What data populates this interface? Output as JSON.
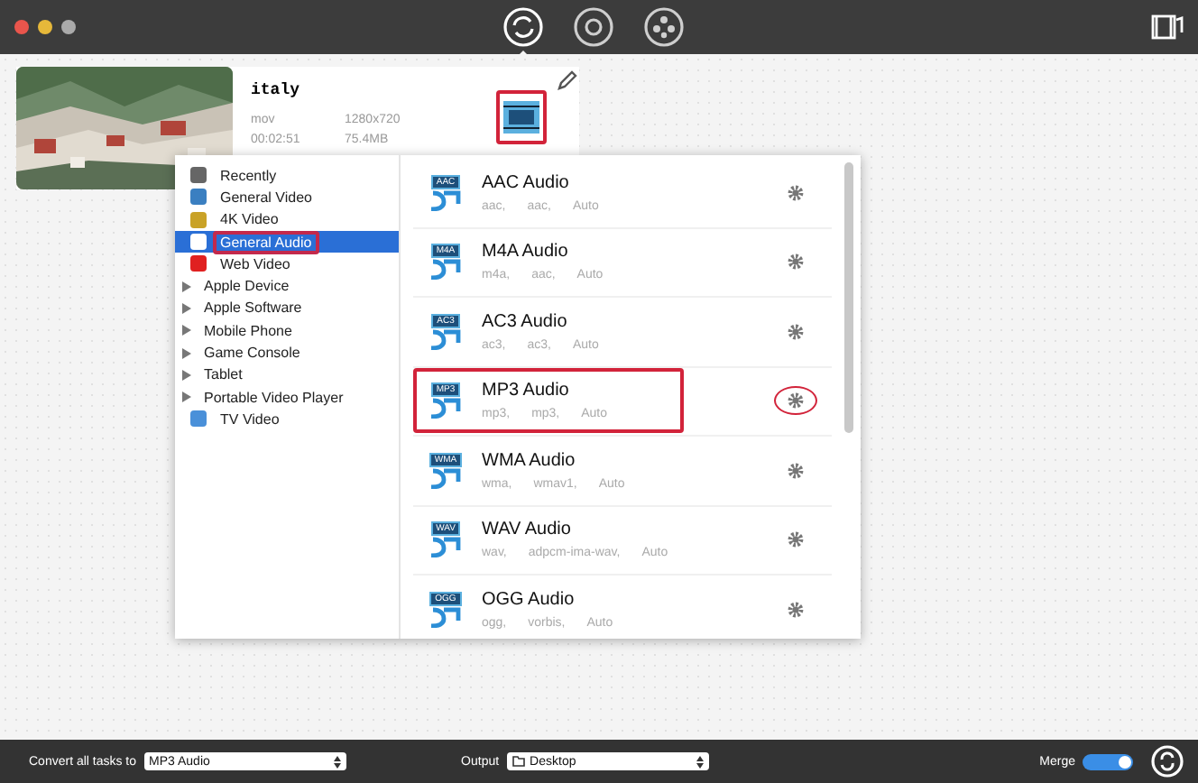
{
  "toolbar": {
    "tabs": [
      {
        "selected": true
      },
      {
        "selected": false
      },
      {
        "selected": false
      }
    ]
  },
  "video": {
    "title": "italy",
    "format": "mov",
    "resolution": "1280x720",
    "duration": "00:02:51",
    "size": "75.4MB",
    "target_marked": true
  },
  "categories": [
    {
      "label": "Recently",
      "kind": "leaf",
      "selected": false,
      "marked": false
    },
    {
      "label": "General Video",
      "kind": "leaf",
      "selected": false,
      "marked": false
    },
    {
      "label": "4K Video",
      "kind": "leaf",
      "selected": false,
      "marked": false
    },
    {
      "label": "General Audio",
      "kind": "leaf",
      "selected": true,
      "marked": true
    },
    {
      "label": "Web Video",
      "kind": "leaf",
      "selected": false,
      "marked": false
    },
    {
      "label": "Apple Device",
      "kind": "group",
      "selected": false,
      "marked": false
    },
    {
      "label": "Apple Software",
      "kind": "group",
      "selected": false,
      "marked": false
    },
    {
      "label": "Mobile Phone",
      "kind": "group",
      "selected": false,
      "marked": false
    },
    {
      "label": "Game Console",
      "kind": "group",
      "selected": false,
      "marked": false
    },
    {
      "label": "Tablet",
      "kind": "group",
      "selected": false,
      "marked": false
    },
    {
      "label": "Portable Video Player",
      "kind": "group",
      "selected": false,
      "marked": false
    },
    {
      "label": "TV Video",
      "kind": "leaf",
      "selected": false,
      "marked": false
    }
  ],
  "formats": [
    {
      "name": "AAC Audio",
      "details": [
        "aac,",
        "aac,",
        "Auto"
      ],
      "marked": false,
      "badge": "AAC"
    },
    {
      "name": "M4A Audio",
      "details": [
        "m4a,",
        "aac,",
        "Auto"
      ],
      "marked": false,
      "badge": "M4A"
    },
    {
      "name": "AC3 Audio",
      "details": [
        "ac3,",
        "ac3,",
        "Auto"
      ],
      "marked": false,
      "badge": "AC3"
    },
    {
      "name": "MP3 Audio",
      "details": [
        "mp3,",
        "mp3,",
        "Auto"
      ],
      "marked": true,
      "badge": "MP3"
    },
    {
      "name": "WMA Audio",
      "details": [
        "wma,",
        "wmav1,",
        "Auto"
      ],
      "marked": false,
      "badge": "WMA"
    },
    {
      "name": "WAV Audio",
      "details": [
        "wav,",
        "adpcm-ima-wav,",
        "Auto"
      ],
      "marked": false,
      "badge": "WAV"
    },
    {
      "name": "OGG Audio",
      "details": [
        "ogg,",
        "vorbis,",
        "Auto"
      ],
      "marked": false,
      "badge": "OGG"
    }
  ],
  "bottom_bar": {
    "convert_label": "Convert all tasks to",
    "convert_value": "MP3 Audio",
    "output_label": "Output",
    "output_value": "Desktop",
    "merge_label": "Merge",
    "merge_on": true
  }
}
